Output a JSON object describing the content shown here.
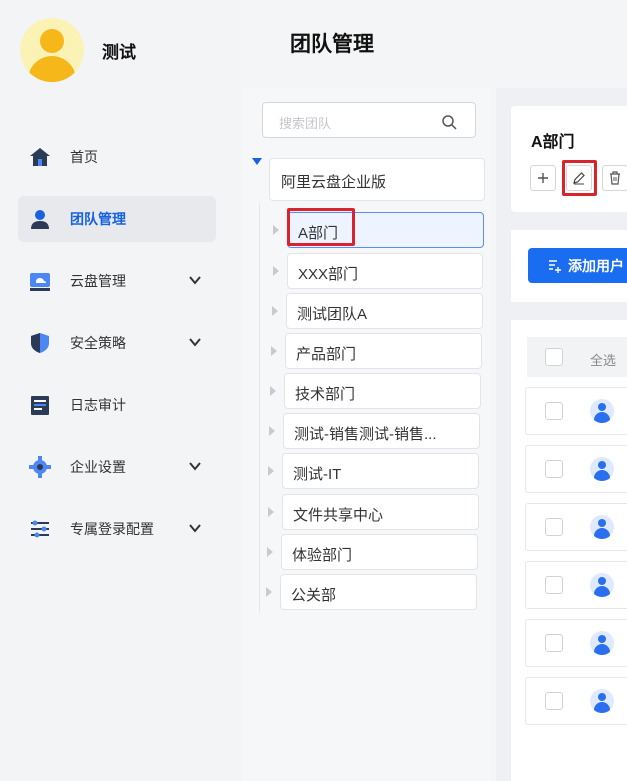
{
  "user": {
    "name": "测试"
  },
  "page_title": "团队管理",
  "sidebar": {
    "items": [
      {
        "label": "首页",
        "icon": "home-icon",
        "active": false,
        "expandable": false
      },
      {
        "label": "团队管理",
        "icon": "user-icon",
        "active": true,
        "expandable": false
      },
      {
        "label": "云盘管理",
        "icon": "cloud-drive-icon",
        "active": false,
        "expandable": true
      },
      {
        "label": "安全策略",
        "icon": "shield-icon",
        "active": false,
        "expandable": true
      },
      {
        "label": "日志审计",
        "icon": "log-icon",
        "active": false,
        "expandable": false
      },
      {
        "label": "企业设置",
        "icon": "gear-icon",
        "active": false,
        "expandable": true
      },
      {
        "label": "专属登录配置",
        "icon": "sliders-icon",
        "active": false,
        "expandable": true
      }
    ]
  },
  "search": {
    "placeholder": "搜索团队"
  },
  "tree": {
    "root": "阿里云盘企业版",
    "children": [
      {
        "label": "A部门",
        "selected": true
      },
      {
        "label": "XXX部门"
      },
      {
        "label": "测试团队A"
      },
      {
        "label": "产品部门"
      },
      {
        "label": "技术部门"
      },
      {
        "label": "测试-销售测试-销售..."
      },
      {
        "label": "测试-IT"
      },
      {
        "label": "文件共享中心"
      },
      {
        "label": "体验部门"
      },
      {
        "label": "公关部"
      }
    ]
  },
  "detail": {
    "title": "A部门",
    "add_user_label": "添加用户",
    "select_all_label": "全选",
    "row_count": 6
  },
  "colors": {
    "accent": "#1a6cf0",
    "highlight": "#d9232d"
  }
}
